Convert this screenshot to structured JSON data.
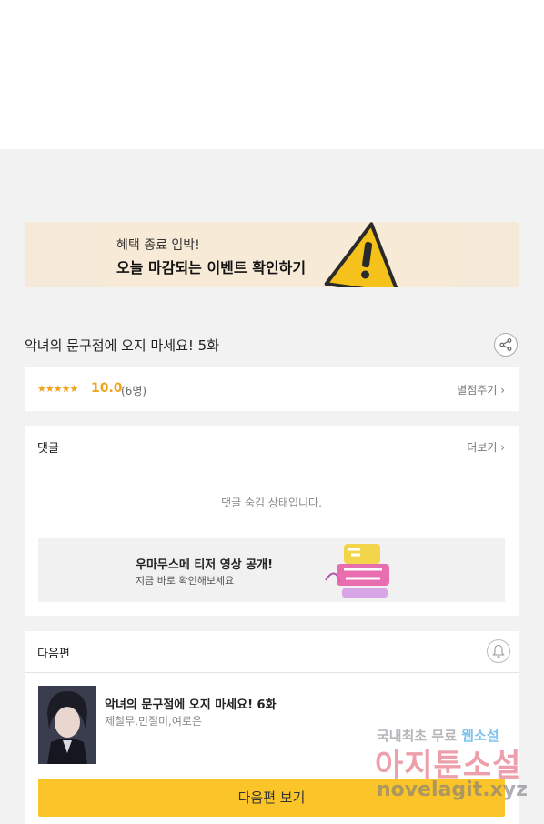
{
  "banner": {
    "line1": "혜택 종료 임박!",
    "line2": "오늘 마감되는 이벤트 확인하기",
    "icon": "warning-icon",
    "icon_color": "#f5c21b"
  },
  "episode": {
    "title": "악녀의 문구점에 오지 마세요! 5화"
  },
  "rating": {
    "stars": "★★★★★",
    "score": "10.0",
    "count": "(6명)",
    "rate_label": "별점주기 ›"
  },
  "comments": {
    "title": "댓글",
    "more_label": "더보기 ›",
    "hidden_message": "댓글 숨김 상태입니다.",
    "ad": {
      "line1": "우마무스메 티저 영상 공개!",
      "line2": "지금 바로 확인해보세요"
    }
  },
  "next": {
    "title": "다음편",
    "episode_title": "악녀의 문구점에 오지 마세요! 6화",
    "authors": "제철무,민절미,여로은",
    "button_label": "다음편 보기"
  },
  "watermark": {
    "line1_part1": "국내최초 무료 ",
    "line1_part2": "웹소설",
    "line2": "아지툰소설",
    "line3": "novelagit.xyz"
  },
  "colors": {
    "accent_yellow": "#fbc52a",
    "rating_orange": "#f0a318",
    "background": "#f2f2f2"
  }
}
